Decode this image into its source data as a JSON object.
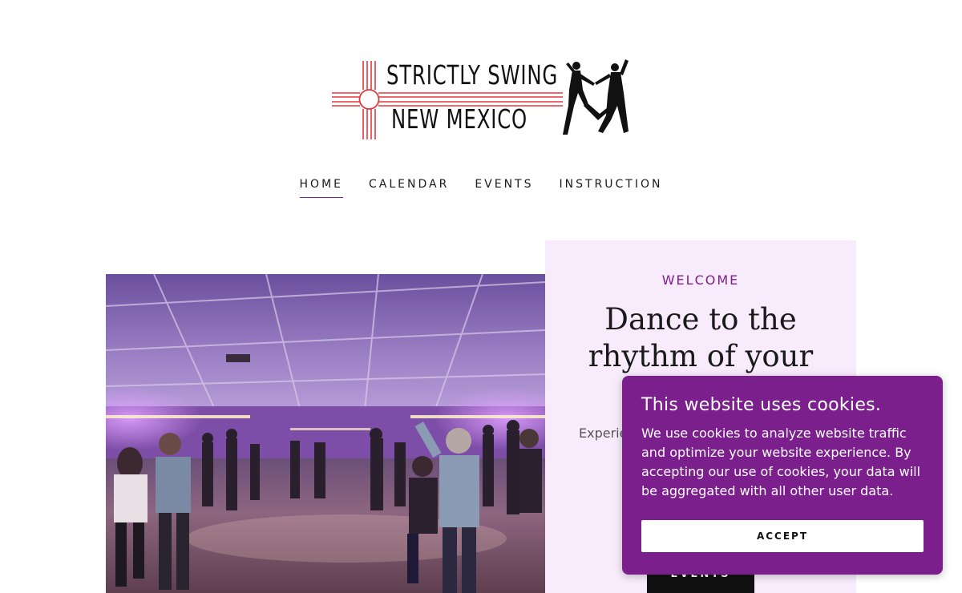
{
  "logo": {
    "line1": "STRICTLY SWING",
    "line2": "NEW MEXICO",
    "icon": "zia-sun-symbol-icon",
    "dancers_icon": "swing-dancers-silhouette-icon",
    "colors": {
      "zia": "#e0393e",
      "text": "#111111"
    }
  },
  "nav": {
    "items": [
      {
        "label": "HOME",
        "active": true
      },
      {
        "label": "CALENDAR",
        "active": false
      },
      {
        "label": "EVENTS",
        "active": false
      },
      {
        "label": "INSTRUCTION",
        "active": false
      }
    ],
    "underline_color": "#7a1f8c"
  },
  "hero": {
    "eyebrow": "WELCOME",
    "headline": "Dance to the rhythm of your",
    "body_visible": "Experie",
    "button_label": "EVENTS",
    "panel_color": "#f8ebfb"
  },
  "cookie_banner": {
    "title": "This website uses cookies.",
    "body": "We use cookies to analyze website traffic and optimize your website experience. By accepting our use of cookies, your data will be aggregated with all other user data.",
    "accept_label": "ACCEPT",
    "background": "#7a1f8c"
  }
}
